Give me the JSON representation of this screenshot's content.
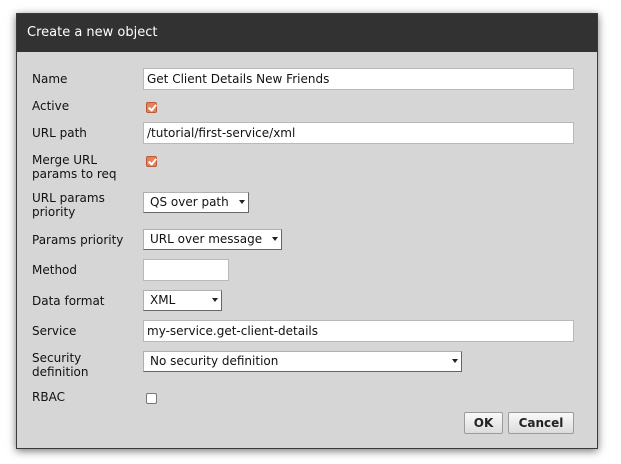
{
  "dialog": {
    "title": "Create a new object"
  },
  "form": {
    "name": {
      "label": "Name",
      "value": "Get Client Details New Friends"
    },
    "active": {
      "label": "Active",
      "checked": true
    },
    "url_path": {
      "label": "URL path",
      "value": "/tutorial/first-service/xml"
    },
    "merge_url_params": {
      "label_line1": "Merge URL",
      "label_line2": "params to req",
      "checked": true
    },
    "url_params_priority": {
      "label_line1": "URL params",
      "label_line2": "priority",
      "selected": "QS over path"
    },
    "params_priority": {
      "label": "Params priority",
      "selected": "URL over message"
    },
    "method": {
      "label": "Method",
      "value": ""
    },
    "data_format": {
      "label": "Data format",
      "selected": "XML"
    },
    "service": {
      "label": "Service",
      "value": "my-service.get-client-details"
    },
    "security_definition": {
      "label_line1": "Security",
      "label_line2": "definition",
      "selected": "No security definition"
    },
    "rbac": {
      "label": "RBAC",
      "checked": false
    }
  },
  "buttons": {
    "ok_label": "OK",
    "cancel_label": "Cancel"
  },
  "colors": {
    "titlebar": "#323232",
    "dialog_bg": "#d6d6d6",
    "checkbox_accent": "#e9805a"
  },
  "icons": [
    "checkbox-checked-icon",
    "checkbox-unchecked-icon",
    "dropdown-arrow-icon"
  ]
}
